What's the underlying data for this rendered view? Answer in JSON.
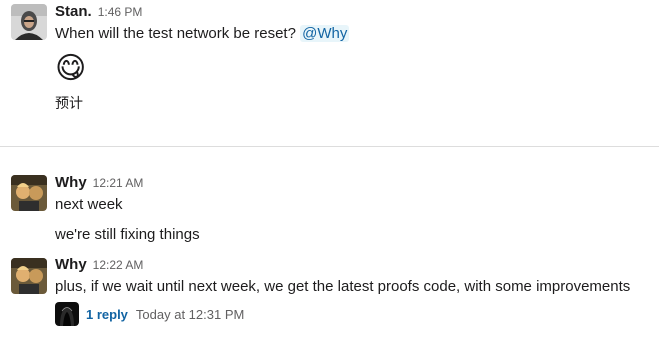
{
  "messages": [
    {
      "author": "Stan.",
      "time": "1:46 PM",
      "lines": [
        "When will the test network be reset?"
      ],
      "mention": "@Why",
      "emoji": "😋",
      "extra": "预计"
    },
    {
      "author": "Why",
      "time": "12:21 AM",
      "lines": [
        "next week",
        "we're still fixing things"
      ]
    },
    {
      "author": "Why",
      "time": "12:22 AM",
      "lines": [
        "plus, if we wait until next week, we get the latest proofs code, with some improvements"
      ],
      "thread": {
        "reply_count": "1 reply",
        "last_reply": "Today at 12:31 PM"
      }
    }
  ],
  "icons": {
    "stan_avatar": "avatar-photo-icon",
    "why_avatar": "avatar-photo-icon",
    "thread_avatar": "hooded-figure-icon"
  },
  "colors": {
    "mention_bg": "#e8f5fa",
    "link": "#1264a3",
    "meta": "#616061"
  }
}
